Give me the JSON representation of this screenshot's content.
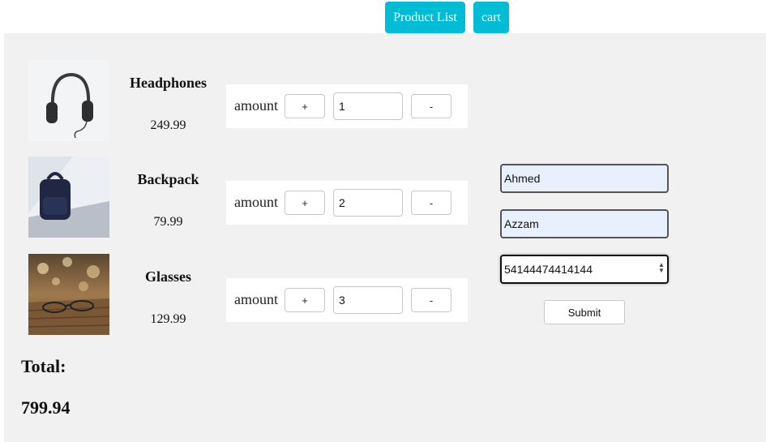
{
  "nav": {
    "product_list_label": "Product List",
    "cart_label": "cart",
    "accent_color": "#00bcd4"
  },
  "products": [
    {
      "name": "Headphones",
      "price": "249.99",
      "amount_label": "amount",
      "plus_label": "+",
      "minus_label": "-",
      "quantity": "1",
      "image": "headphones"
    },
    {
      "name": "Backpack",
      "price": "79.99",
      "amount_label": "amount",
      "plus_label": "+",
      "minus_label": "-",
      "quantity": "2",
      "image": "backpack"
    },
    {
      "name": "Glasses",
      "price": "129.99",
      "amount_label": "amount",
      "plus_label": "+",
      "minus_label": "-",
      "quantity": "3",
      "image": "glasses"
    }
  ],
  "form": {
    "first_field_value": "Ahmed",
    "second_field_value": "Azzam",
    "number_field_value": "54144474414144",
    "submit_label": "Submit"
  },
  "total": {
    "label": "Total:",
    "value": "799.94"
  }
}
